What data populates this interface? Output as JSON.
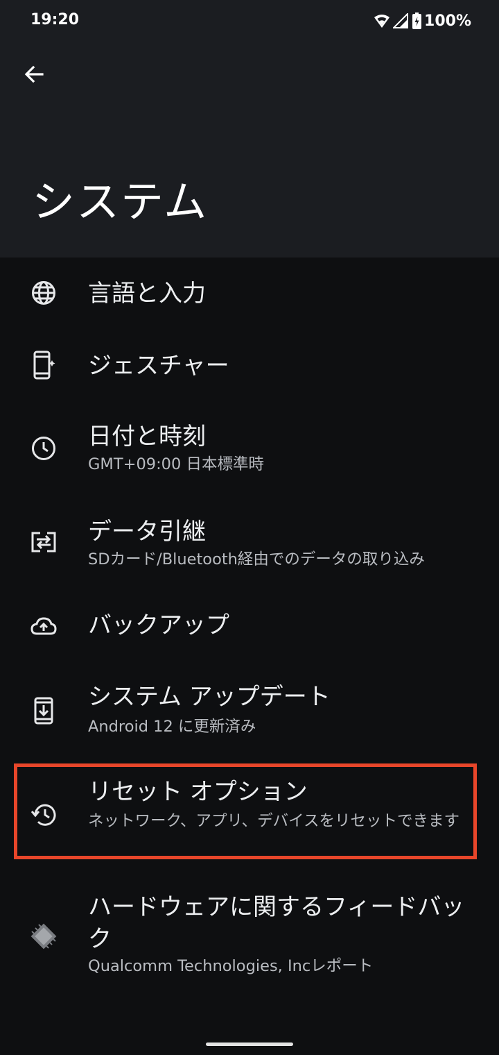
{
  "status_bar": {
    "time": "19:20",
    "battery": "100%",
    "icons": [
      "wifi-icon",
      "signal-icon",
      "battery-charging-icon"
    ]
  },
  "header": {
    "back_icon": "arrow-back-icon",
    "title": "システム"
  },
  "items": [
    {
      "id": "language",
      "icon": "globe-icon",
      "title": "言語と入力",
      "subtitle": ""
    },
    {
      "id": "gestures",
      "icon": "phone-gesture-icon",
      "title": "ジェスチャー",
      "subtitle": ""
    },
    {
      "id": "datetime",
      "icon": "clock-icon",
      "title": "日付と時刻",
      "subtitle": "GMT+09:00 日本標準時"
    },
    {
      "id": "transfer",
      "icon": "data-transfer-icon",
      "title": "データ引継",
      "subtitle": "SDカード/Bluetooth経由でのデータの取り込み"
    },
    {
      "id": "backup",
      "icon": "cloud-upload-icon",
      "title": "バックアップ",
      "subtitle": ""
    },
    {
      "id": "system-update",
      "icon": "system-update-icon",
      "title": "システム アップデート",
      "subtitle": "Android 12 に更新済み"
    },
    {
      "id": "reset",
      "icon": "history-icon",
      "title": "リセット オプション",
      "subtitle": "ネットワーク、アプリ、デバイスをリセットできます"
    },
    {
      "id": "hardware-feedback",
      "icon": "chip-icon",
      "title": "ハードウェアに関するフィードバック",
      "subtitle": "Qualcomm Technologies, Incレポート"
    }
  ],
  "colors": {
    "header_bg": "#1b1d21",
    "page_bg": "#0e0f11",
    "highlight": "#e8462a"
  }
}
